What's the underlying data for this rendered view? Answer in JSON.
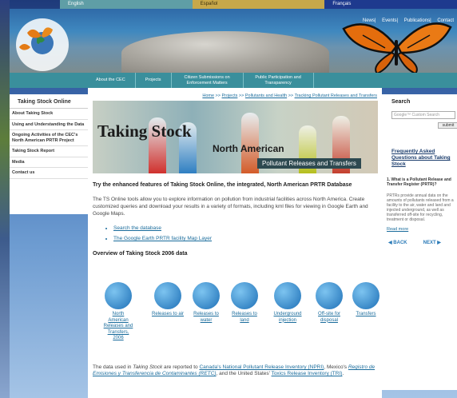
{
  "languages": [
    "English",
    "Español",
    "Français"
  ],
  "toplinks": [
    "News",
    "Events",
    "Publications",
    "Contact"
  ],
  "logo": {
    "text": "CEC·CCA·CCE"
  },
  "nav": [
    "About the CEC",
    "Projects",
    "Citizen Submissions on Enforcement Matters",
    "Public Participation and Transparency"
  ],
  "leftnav": {
    "title": "Taking Stock Online",
    "items": [
      "About Taking Stock",
      "Using and Understanding the Data",
      "Ongoing Activities of the CEC's North American PRTR Project",
      "Taking Stock Report",
      "Media",
      "Contact us"
    ]
  },
  "breadcrumb": [
    "Home",
    "Projects",
    "Pollutants and Health",
    "Tracking Pollutant Releases and Transfers"
  ],
  "banner": {
    "t1": "Taking Stock",
    "t2": "North American",
    "t3": "Pollutant Releases and Transfers"
  },
  "intro": "Try the enhanced features of Taking Stock Online, the integrated, North American PRTR Database",
  "para": "The TS Online tools allow you to explore information on pollution from industrial facilities across North America. Create customized queries and download your results in a variety of formats, including kml files for viewing in Google Earth and Google Maps.",
  "links": [
    "Search the database",
    "The Google Earth PRTR facility Map Layer"
  ],
  "overview": "Overview of Taking Stock 2006 data",
  "icons": [
    "North American Releases and Transfers, 2006",
    "Releases to air",
    "Releases to water",
    "Releases to land",
    "Underground injection",
    "Off-site for disposal",
    "Transfers"
  ],
  "footnote": {
    "pre": "The data used in ",
    "em": "Taking Stock",
    "mid": " are reported to ",
    "l1": "Canada's National Pollutant Release Inventory (NPRI)",
    "mid2": ", Mexico's ",
    "l2": "Registro de Emisiones y Transferencia de Contaminantes (RETC)",
    "mid3": ", and the United States' ",
    "l3": "Toxics Release Inventory (TRI)",
    "end": "."
  },
  "right": {
    "search_title": "Search",
    "search_placeholder": "Google™ Custom Search",
    "submit": "submit",
    "faq_title": "Frequently Asked Questions about Taking Stock",
    "faq_q": "1. What is a Pollutant Release and Transfer Register (PRTR)?",
    "faq_p": "PRTRs provide annual data on the amounts of pollutants released from a facility to the air, water and land and injected underground, as well as transferred off-site for recycling, treatment or disposal.",
    "read_more": "Read more",
    "back": "◀ BACK",
    "next": "NEXT ▶"
  }
}
